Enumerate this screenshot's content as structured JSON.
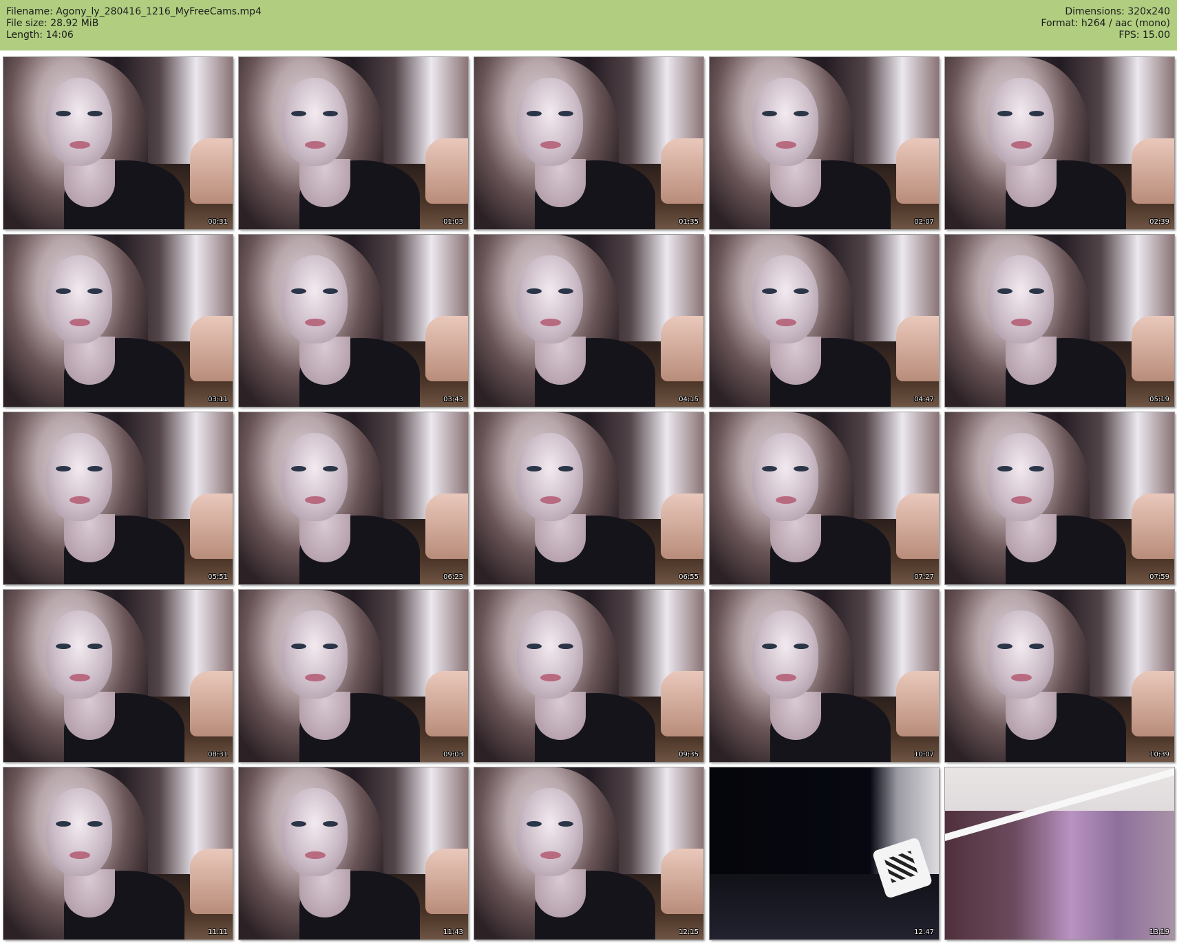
{
  "header": {
    "filename_label": "Filename: Agony_ly_280416_1216_MyFreeCams.mp4",
    "filesize_label": "File size: 28.92 MiB",
    "length_label": "Length: 14:06",
    "dimensions_label": "Dimensions: 320x240",
    "format_label": "Format: h264 / aac (mono)",
    "fps_label": "FPS: 15.00"
  },
  "thumbnails": [
    {
      "timestamp": "00:31",
      "kind": "person"
    },
    {
      "timestamp": "01:03",
      "kind": "person"
    },
    {
      "timestamp": "01:35",
      "kind": "person"
    },
    {
      "timestamp": "02:07",
      "kind": "person"
    },
    {
      "timestamp": "02:39",
      "kind": "person"
    },
    {
      "timestamp": "03:11",
      "kind": "person"
    },
    {
      "timestamp": "03:43",
      "kind": "person"
    },
    {
      "timestamp": "04:15",
      "kind": "person"
    },
    {
      "timestamp": "04:47",
      "kind": "person"
    },
    {
      "timestamp": "05:19",
      "kind": "person"
    },
    {
      "timestamp": "05:51",
      "kind": "person"
    },
    {
      "timestamp": "06:23",
      "kind": "person"
    },
    {
      "timestamp": "06:55",
      "kind": "person"
    },
    {
      "timestamp": "07:27",
      "kind": "person"
    },
    {
      "timestamp": "07:59",
      "kind": "person"
    },
    {
      "timestamp": "08:31",
      "kind": "person"
    },
    {
      "timestamp": "09:03",
      "kind": "person"
    },
    {
      "timestamp": "09:35",
      "kind": "person"
    },
    {
      "timestamp": "10:07",
      "kind": "person"
    },
    {
      "timestamp": "10:39",
      "kind": "person"
    },
    {
      "timestamp": "11:11",
      "kind": "person"
    },
    {
      "timestamp": "11:43",
      "kind": "person"
    },
    {
      "timestamp": "12:15",
      "kind": "person"
    },
    {
      "timestamp": "12:47",
      "kind": "dark"
    },
    {
      "timestamp": "13:19",
      "kind": "room"
    }
  ],
  "colors": {
    "header_bg": "#b0cd80",
    "timestamp_text": "#f2f2f2"
  }
}
